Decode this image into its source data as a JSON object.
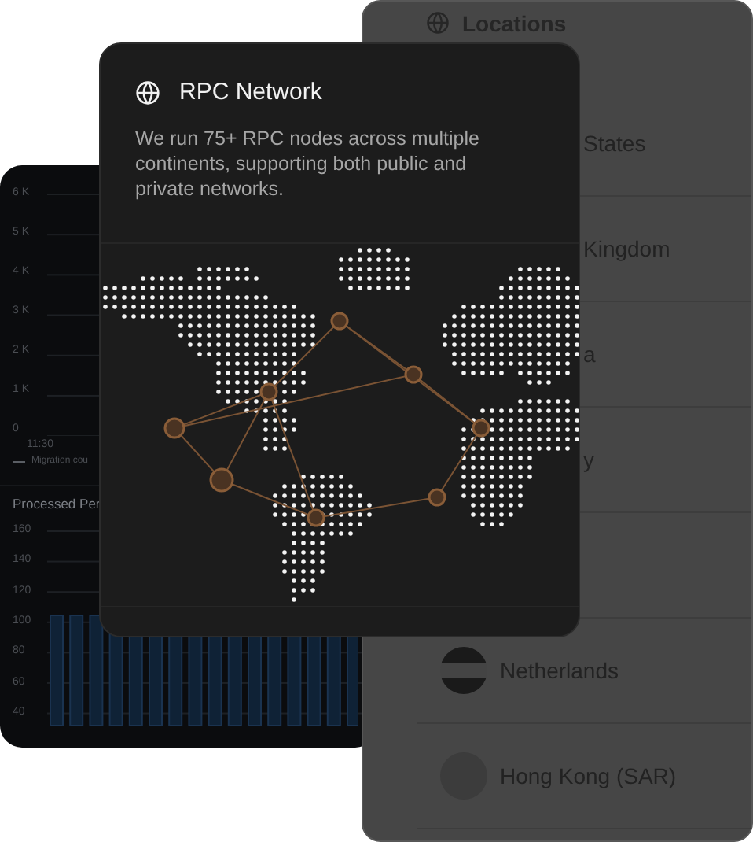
{
  "metrics_card": {
    "top_chart": {
      "y_ticks": [
        "6 K",
        "5 K",
        "4 K",
        "3 K",
        "2 K",
        "1 K",
        "0"
      ],
      "x_label": "11:30",
      "legend": "Migration cou"
    },
    "bottom_chart": {
      "title": "Processed Per",
      "y_ticks": [
        "160",
        "140",
        "120",
        "100",
        "80",
        "60",
        "40"
      ]
    }
  },
  "locations_panel": {
    "title": "Locations",
    "rows": [
      {
        "name": "States",
        "kind": "hidden"
      },
      {
        "name": "Kingdom",
        "kind": "hidden"
      },
      {
        "name": "a",
        "kind": "hidden"
      },
      {
        "name": "y",
        "kind": "hidden"
      },
      {
        "kind": "hidden"
      },
      {
        "name": "Netherlands",
        "kind": "striped"
      },
      {
        "name": "Hong Kong (SAR)",
        "kind": "plain"
      }
    ]
  },
  "rpc_card": {
    "title": "RPC Network",
    "description": "We run 75+ RPC nodes across multiple continents, supporting both public and private networks."
  }
}
